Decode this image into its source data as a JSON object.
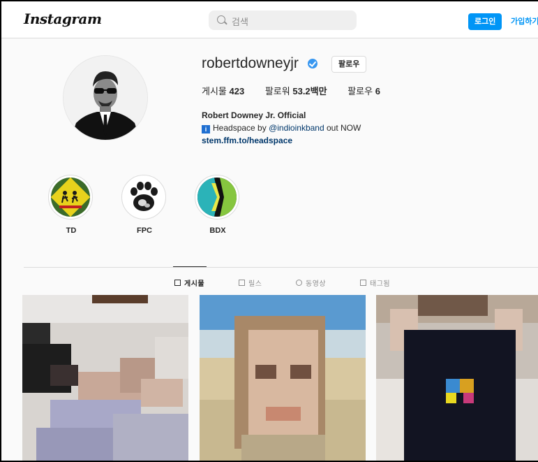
{
  "header": {
    "logo": "Instagram",
    "search_placeholder": "검색",
    "login_label": "로그인",
    "signup_label": "가입하기"
  },
  "profile": {
    "username": "robertdowneyjr",
    "verified": true,
    "follow_label": "팔로우",
    "stats": {
      "posts_label": "게시물",
      "posts_value": "423",
      "followers_label": "팔로워",
      "followers_value": "53.2백만",
      "following_label": "팔로우",
      "following_value": "6"
    },
    "bio": {
      "name": "Robert Downey Jr. Official",
      "line_prefix": "Headspace by",
      "mention": "@indioinkband",
      "line_suffix": "out NOW",
      "link": "stem.ffm.to/headspace"
    }
  },
  "highlights": [
    {
      "label": "TD"
    },
    {
      "label": "FPC"
    },
    {
      "label": "BDX"
    }
  ],
  "tabs": [
    {
      "label": "게시물",
      "icon": "grid-icon",
      "active": true
    },
    {
      "label": "릴스",
      "icon": "reels-icon",
      "active": false
    },
    {
      "label": "동영상",
      "icon": "play-icon",
      "active": false
    },
    {
      "label": "태그됨",
      "icon": "tag-icon",
      "active": false
    }
  ],
  "colors": {
    "accent": "#0095f6",
    "verified": "#3897f0",
    "link": "#00376b"
  }
}
